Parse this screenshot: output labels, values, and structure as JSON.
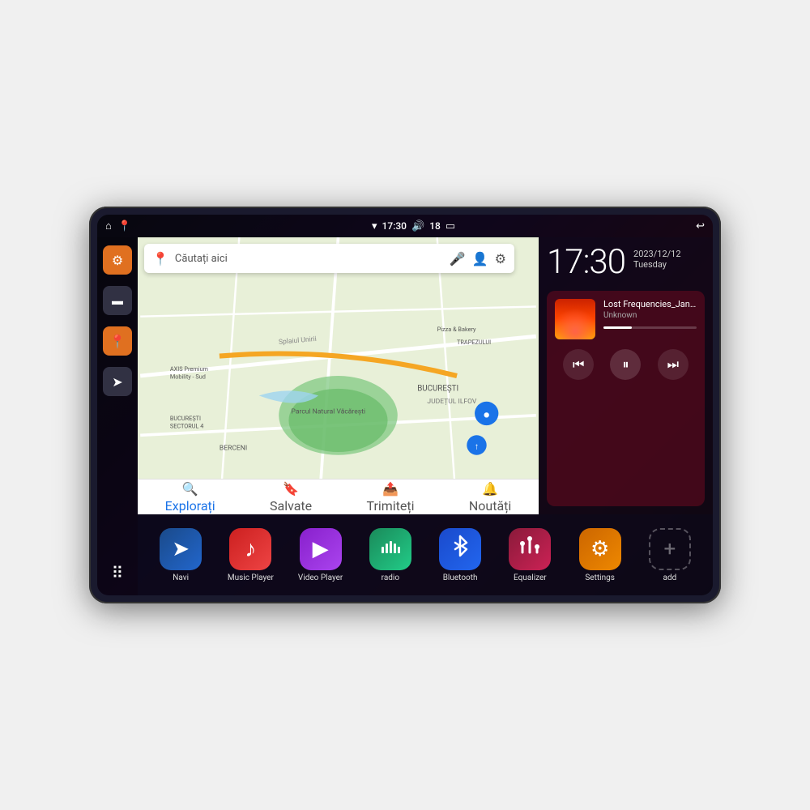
{
  "device": {
    "status_bar": {
      "left_icons": [
        "home",
        "maps"
      ],
      "time": "17:30",
      "right_icons": [
        "wifi",
        "volume",
        "18",
        "battery",
        "back"
      ]
    },
    "clock": {
      "time": "17:30",
      "date": "2023/12/12",
      "day": "Tuesday"
    },
    "music": {
      "title": "Lost Frequencies_Janie...",
      "artist": "Unknown",
      "album_art_alt": "Concert crowd",
      "controls": {
        "prev": "⏮",
        "play": "⏸",
        "next": "⏭"
      }
    },
    "map": {
      "search_placeholder": "Căutați aici",
      "locations": [
        "AXIS Premium Mobility - Sud",
        "Parcul Natural Văcărești",
        "Pizza & Bakery",
        "TRAPEZULUI",
        "BUCUREȘTI SECTORUL 4",
        "BERCENI",
        "BUCUREȘTI",
        "JUDEȚUL ILFOV"
      ],
      "bottom_bar": [
        {
          "label": "Explorați",
          "icon": "🔍",
          "active": true
        },
        {
          "label": "Salvate",
          "icon": "🔖",
          "active": false
        },
        {
          "label": "Trimiteți",
          "icon": "📤",
          "active": false
        },
        {
          "label": "Noutăți",
          "icon": "🔔",
          "active": false
        }
      ]
    },
    "sidebar": {
      "items": [
        {
          "icon": "⚙",
          "color": "orange",
          "name": "settings"
        },
        {
          "icon": "▬",
          "color": "dark",
          "name": "files"
        },
        {
          "icon": "📍",
          "color": "orange",
          "name": "maps"
        },
        {
          "icon": "➤",
          "color": "dark",
          "name": "navigation"
        }
      ],
      "grid_btn": "⋮⋮⋮"
    },
    "apps": [
      {
        "label": "Navi",
        "icon": "➤",
        "color": "blue-dark"
      },
      {
        "label": "Music Player",
        "icon": "♪",
        "color": "red"
      },
      {
        "label": "Video Player",
        "icon": "▶",
        "color": "purple"
      },
      {
        "label": "radio",
        "icon": "📶",
        "color": "green-teal"
      },
      {
        "label": "Bluetooth",
        "icon": "⚡",
        "color": "blue-bt"
      },
      {
        "label": "Equalizer",
        "icon": "🎚",
        "color": "dark-red"
      },
      {
        "label": "Settings",
        "icon": "⚙",
        "color": "orange"
      },
      {
        "label": "add",
        "icon": "+",
        "color": "grey-dashed"
      }
    ]
  }
}
